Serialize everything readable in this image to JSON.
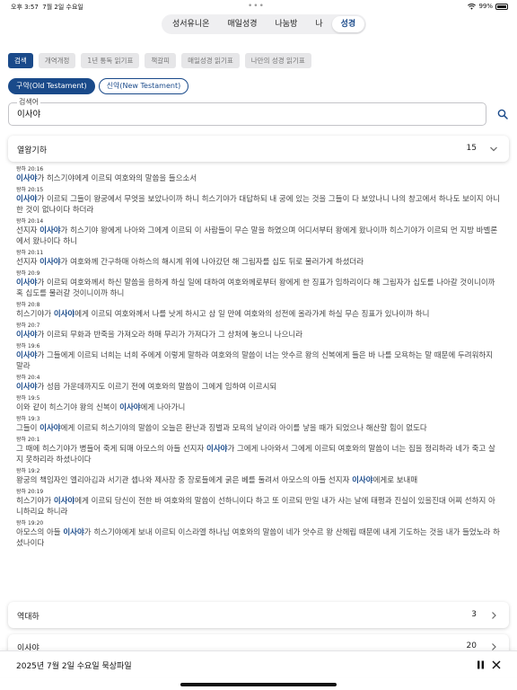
{
  "status": {
    "time": "오후 3:57",
    "date": "7월 2일 수요일",
    "battery": "99%"
  },
  "topnav": [
    "성서유니온",
    "매일성경",
    "나눔방",
    "나",
    "성경"
  ],
  "tabs": [
    "검색",
    "개역개정",
    "1년 통독 읽기표",
    "책갈피",
    "매일성경 읽기표",
    "나만의 성경 읽기표"
  ],
  "testament": [
    "구약(Old Testament)",
    "신약(New Testament)"
  ],
  "search": {
    "label": "검색어",
    "value": "이사야"
  },
  "books": [
    {
      "name": "열왕기하",
      "count": "15"
    },
    {
      "name": "역대하",
      "count": "3"
    },
    {
      "name": "이사야",
      "count": "20"
    }
  ],
  "results": [
    {
      "ref": "왕하 20:16",
      "pre": "",
      "hl": "이사야",
      "post": "가 히스기야에게 이르되 여호와의 말씀을 들으소서"
    },
    {
      "ref": "왕하 20:15",
      "pre": "",
      "hl": "이사야",
      "post": "가 이르되 그들이 왕궁에서 무엇을 보았나이까 하니 히스기야가 대답하되 내 궁에 있는 것을 그들이 다 보았나니 나의 창고에서 하나도 보이지 아니한 것이 없나이다 하더라"
    },
    {
      "ref": "왕하 20:14",
      "pre": "선지자 ",
      "hl": "이사야",
      "post": "가 히스기야 왕에게 나아와 그에게 이르되 이 사람들이 무슨 말을 하였으며 어디서부터 왕에게 왔나이까 히스기야가 이르되 먼 지방 바벨론에서 왔나이다 하니"
    },
    {
      "ref": "왕하 20:11",
      "pre": "선지자 ",
      "hl": "이사야",
      "post": "가 여호와께 간구하매 아하스의 해시계 위에 나아갔던 해 그림자를 십도 뒤로 물러가게 하셨더라"
    },
    {
      "ref": "왕하 20:9",
      "pre": "",
      "hl": "이사야",
      "post": "가 이르되 여호와께서 하신 말씀을 응하게 하실 일에 대하여 여호와께로부터 왕에게 한 징표가 임하리이다 해 그림자가 십도를 나아갈 것이니이까 혹 십도를 물러갈 것이니이까 하니"
    },
    {
      "ref": "왕하 20:8",
      "pre": "히스기야가 ",
      "hl": "이사야",
      "post": "에게 이르되 여호와께서 나를 낫게 하시고 삼 일 만에 여호와의 성전에 올라가게 하실 무슨 징표가 있나이까 하니"
    },
    {
      "ref": "왕하 20:7",
      "pre": "",
      "hl": "이사야",
      "post": "가 이르되 무화과 반죽을 가져오라 하매 무리가 가져다가 그 상처에 놓으니 나으니라"
    },
    {
      "ref": "왕하 19:6",
      "pre": "",
      "hl": "이사야",
      "post": "가 그들에게 이르되 너희는 너희 주에게 이렇게 말하라 여호와의 말씀이 너는 앗수르 왕의 신복에게 들은 바 나를 모욕하는 말 때문에 두려워하지 말라"
    },
    {
      "ref": "왕하 20:4",
      "pre": "",
      "hl": "이사야",
      "post": "가 성읍 가운데까지도 이르기 전에 여호와의 말씀이 그에게 임하여 이르시되"
    },
    {
      "ref": "왕하 19:5",
      "pre": "이와 같이 히스기야 왕의 신복이 ",
      "hl": "이사야",
      "post": "에게 나아가니"
    },
    {
      "ref": "왕하 19:3",
      "pre": "그들이 ",
      "hl": "이사야",
      "post": "에게 이르되 히스기야의 말씀이 오늘은 환난과 징벌과 모욕의 날이라 아이를 낳을 때가 되었으나 해산할 힘이 없도다"
    },
    {
      "ref": "왕하 20:1",
      "pre": "그 때에 히스기야가 병들어 죽게 되매 아모스의 아들 선지자 ",
      "hl": "이사야",
      "post": "가 그에게 나아와서 그에게 이르되 여호와의 말씀이 너는 집을 정리하라 네가 죽고 살지 못하리라 하셨나이다"
    },
    {
      "ref": "왕하 19:2",
      "pre": "왕궁의 책임자인 엘리아김과 서기관 셉나와 제사장 중 장로들에게 굵은 베를 둘려서 아모스의 아들 선지자 ",
      "hl": "이사야",
      "post": "에게로 보내매"
    },
    {
      "ref": "왕하 20:19",
      "pre": "히스기야가 ",
      "hl": "이사야",
      "post": "에게 이르되 당신이 전한 바 여호와의 말씀이 선하니이다 하고 또 이르되 만일 내가 사는 날에 태평과 진실이 있을진대 어찌 선하지 아니하리요 하니라"
    },
    {
      "ref": "왕하 19:20",
      "pre": "아모스의 아들 ",
      "hl": "이사야",
      "post": "가 히스기야에게 보내 이르되 이스라엘 하나님 여호와의 말씀이 네가 앗수르 왕 산헤립 때문에 내게 기도하는 것을 내가 들었노라 하셨나이다"
    }
  ],
  "player": {
    "title": "2025년 7월 2일 수요일 묵상파일"
  },
  "icons": {
    "search": "search-icon",
    "chevron_down": "chevron-down-icon",
    "chevron_right": "chevron-right-icon",
    "pause": "pause-icon",
    "close": "close-icon"
  },
  "colors": {
    "accent": "#1a4a8a",
    "tab_inactive": "#e6e6e8"
  }
}
